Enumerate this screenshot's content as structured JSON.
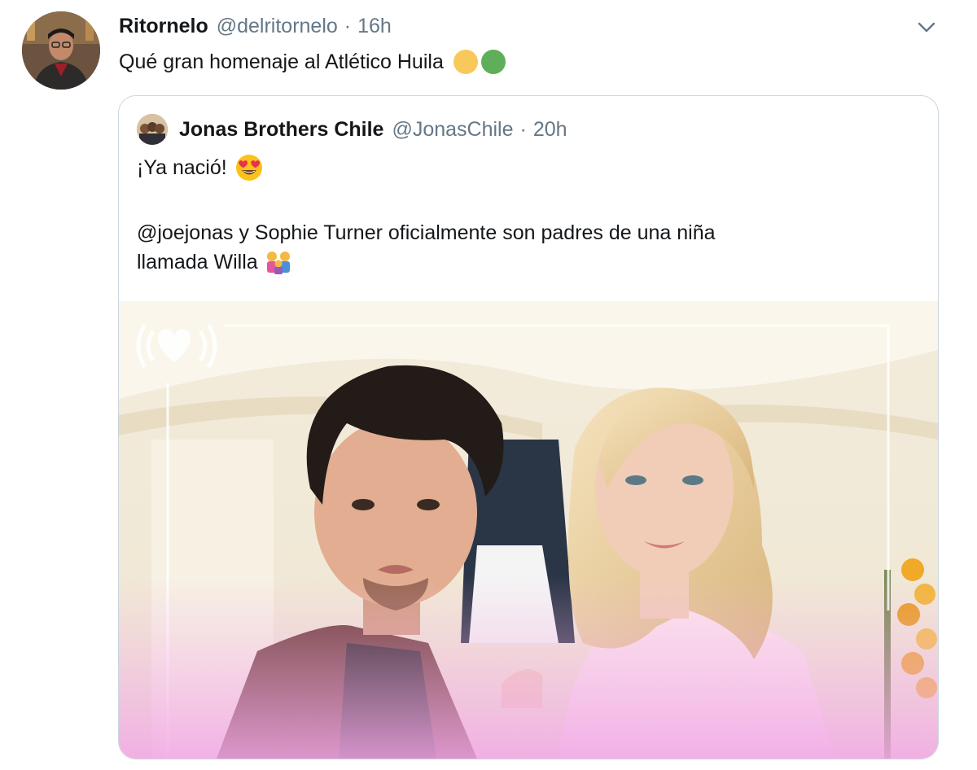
{
  "tweet": {
    "author_name": "Ritornelo",
    "author_handle": "@delritornelo",
    "separator": "·",
    "time": "16h",
    "text": "Qué gran homenaje al Atlético Huila",
    "emoji_colors": [
      "#f9c85b",
      "#5fae5a"
    ]
  },
  "quoted": {
    "author_name": "Jonas Brothers Chile",
    "author_handle": "@JonasChile",
    "separator": "·",
    "time": "20h",
    "line1": "¡Ya nació!",
    "line2": "@joejonas y Sophie Turner oficialmente son padres de una niña",
    "line3": "llamada Willa",
    "media_alt": "iHeartRadio photo of Joe Jonas and Sophie Turner"
  },
  "icons": {
    "more": "chevron-down-icon",
    "heart_eyes": "heart-eyes-emoji-icon",
    "family": "family-emoji-icon",
    "media_logo": "iheartradio-logo-icon"
  }
}
